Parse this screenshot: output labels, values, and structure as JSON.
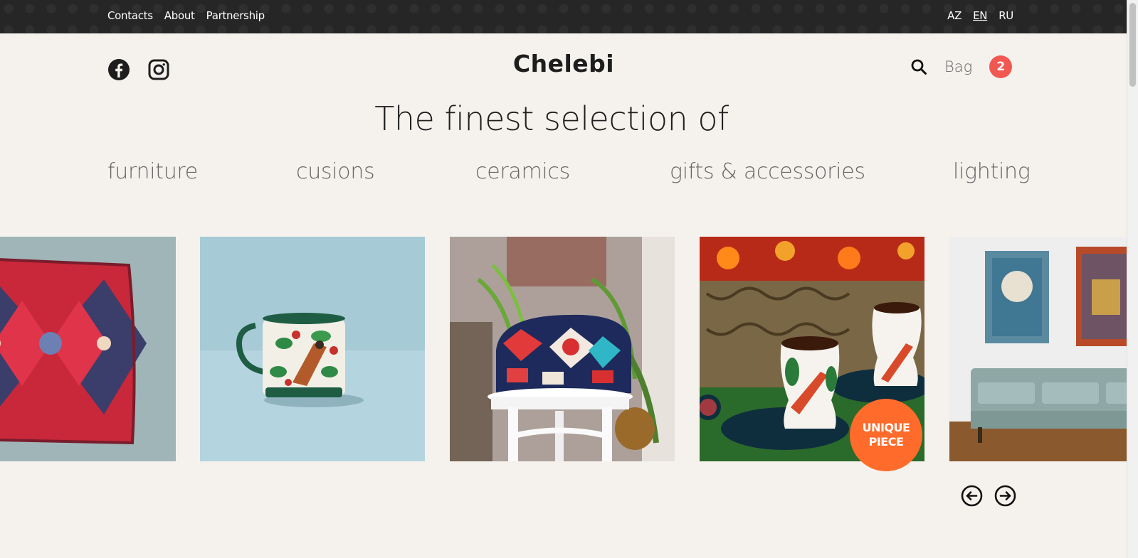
{
  "topbar": {
    "links": [
      "Contacts",
      "About",
      "Partnership"
    ],
    "languages": [
      "AZ",
      "EN",
      "RU"
    ],
    "active_language": "EN"
  },
  "header": {
    "logo": "Chelebi",
    "bag_label": "Bag",
    "bag_count": "2",
    "social_icons": [
      "facebook-icon",
      "instagram-icon"
    ]
  },
  "hero": {
    "headline": "The finest selection of"
  },
  "categories": [
    "furniture",
    "cusions",
    "ceramics",
    "gifts & accessories",
    "lighting"
  ],
  "carousel": {
    "items": [
      "cushion",
      "mug",
      "bag-on-stool",
      "tea-glasses",
      "sofa"
    ],
    "badge_line1": "UNIQUE",
    "badge_line2": "PIECE"
  },
  "colors": {
    "topbar": "#262626",
    "background": "#f5f2ee",
    "bag_badge": "#f25852",
    "unique_badge": "#ff6b2a"
  }
}
